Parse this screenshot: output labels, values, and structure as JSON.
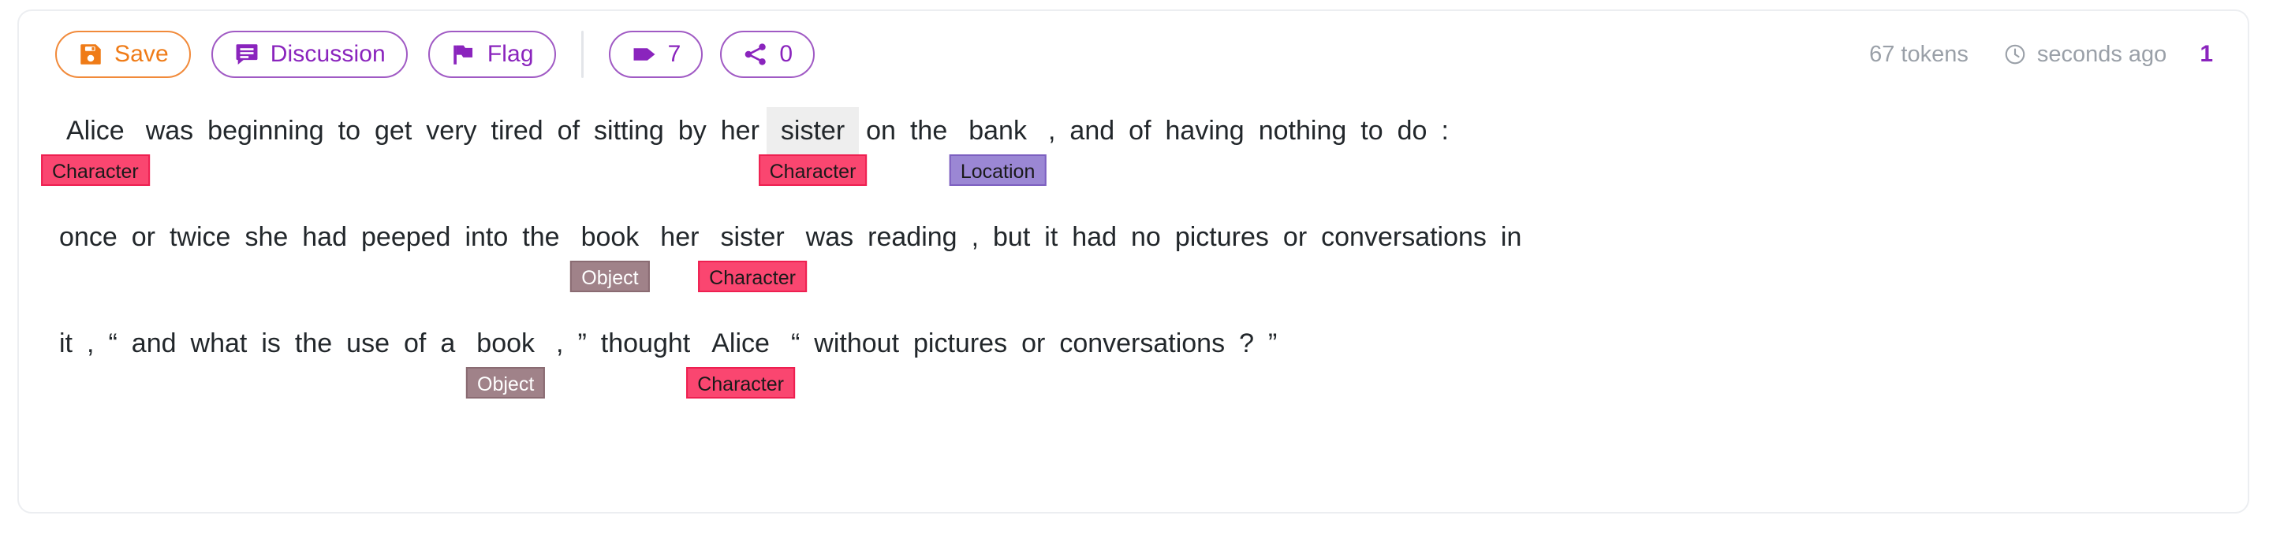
{
  "toolbar": {
    "save": {
      "label": "Save",
      "icon": "save-icon",
      "color": "#ef7b17"
    },
    "discussion": {
      "label": "Discussion",
      "icon": "comment-icon",
      "color": "#8a24bd"
    },
    "flag": {
      "label": "Flag",
      "icon": "flag-icon",
      "color": "#8a24bd"
    },
    "tag": {
      "label": "7",
      "icon": "tag-icon",
      "color": "#8a24bd"
    },
    "share": {
      "label": "0",
      "icon": "share-icon",
      "color": "#8a24bd"
    },
    "tokens": "67 tokens",
    "clock_icon": "clock-icon",
    "updated": "seconds ago",
    "version": "1",
    "version_color": "#8a24bd"
  },
  "legend": {
    "character": {
      "label": "Character",
      "bg": "#fa4670",
      "border": "#ee1f50",
      "fg": "#1a1a1a"
    },
    "location": {
      "label": "Location",
      "bg": "#9b87d4",
      "border": "#7c5fc0",
      "fg": "#1a1a1a"
    },
    "object": {
      "label": "Object",
      "bg": "#a08289",
      "border": "#8a6b72",
      "fg": "#ffffff"
    }
  },
  "annotation": {
    "highlight_bg": "#eeeeee",
    "lines": [
      {
        "tokens": [
          {
            "text": "Alice",
            "label": "Character",
            "type": "character"
          },
          {
            "text": "was"
          },
          {
            "text": "beginning"
          },
          {
            "text": "to"
          },
          {
            "text": "get"
          },
          {
            "text": "very"
          },
          {
            "text": "tired"
          },
          {
            "text": "of"
          },
          {
            "text": "sitting"
          },
          {
            "text": "by"
          },
          {
            "text": "her"
          },
          {
            "text": "sister",
            "label": "Character",
            "type": "character",
            "hover": true
          },
          {
            "text": "on"
          },
          {
            "text": "the"
          },
          {
            "text": "bank",
            "label": "Location",
            "type": "location"
          },
          {
            "text": ","
          },
          {
            "text": "and"
          },
          {
            "text": "of"
          },
          {
            "text": "having"
          },
          {
            "text": "nothing"
          },
          {
            "text": "to"
          },
          {
            "text": "do"
          },
          {
            "text": ":"
          }
        ]
      },
      {
        "tokens": [
          {
            "text": "once"
          },
          {
            "text": "or"
          },
          {
            "text": "twice"
          },
          {
            "text": "she"
          },
          {
            "text": "had"
          },
          {
            "text": "peeped"
          },
          {
            "text": "into"
          },
          {
            "text": "the"
          },
          {
            "text": "book",
            "label": "Object",
            "type": "object"
          },
          {
            "text": "her"
          },
          {
            "text": "sister",
            "label": "Character",
            "type": "character"
          },
          {
            "text": "was"
          },
          {
            "text": "reading"
          },
          {
            "text": ","
          },
          {
            "text": "but"
          },
          {
            "text": "it"
          },
          {
            "text": "had"
          },
          {
            "text": "no"
          },
          {
            "text": "pictures"
          },
          {
            "text": "or"
          },
          {
            "text": "conversations"
          },
          {
            "text": "in"
          }
        ]
      },
      {
        "tokens": [
          {
            "text": "it"
          },
          {
            "text": ","
          },
          {
            "text": "“"
          },
          {
            "text": "and"
          },
          {
            "text": "what"
          },
          {
            "text": "is"
          },
          {
            "text": "the"
          },
          {
            "text": "use"
          },
          {
            "text": "of"
          },
          {
            "text": "a"
          },
          {
            "text": "book",
            "label": "Object",
            "type": "object"
          },
          {
            "text": ","
          },
          {
            "text": "”"
          },
          {
            "text": "thought"
          },
          {
            "text": "Alice",
            "label": "Character",
            "type": "character"
          },
          {
            "text": "“"
          },
          {
            "text": "without"
          },
          {
            "text": "pictures"
          },
          {
            "text": "or"
          },
          {
            "text": "conversations"
          },
          {
            "text": "?"
          },
          {
            "text": "”"
          }
        ]
      }
    ]
  }
}
